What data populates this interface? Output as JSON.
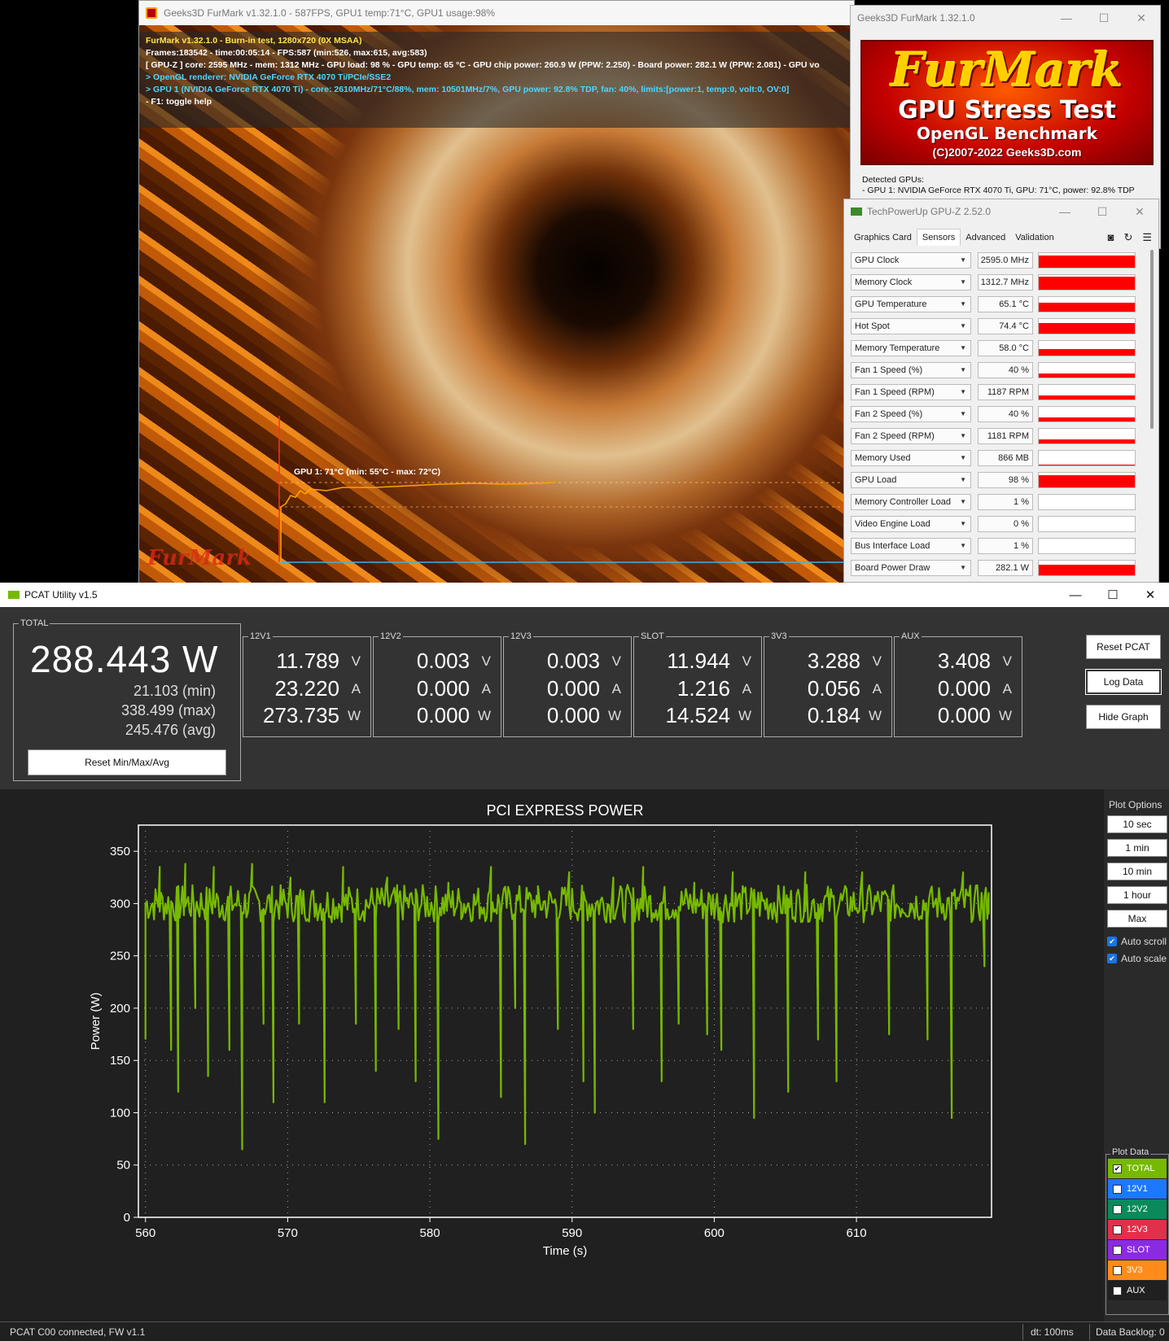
{
  "furmark": {
    "title": "Geeks3D FurMark v1.32.1.0 - 587FPS, GPU1 temp:71°C, GPU1 usage:98%",
    "osd": [
      {
        "text": "FurMark v1.32.1.0 - Burn-in test, 1280x720 (0X MSAA)",
        "color": "yellow"
      },
      {
        "text": "Frames:183542 - time:00:05:14 - FPS:587 (min:526, max:615, avg:583)",
        "color": "white"
      },
      {
        "text": "[ GPU-Z ] core: 2595 MHz - mem: 1312 MHz - GPU load: 98 % - GPU temp: 65 °C - GPU chip power: 260.9 W (PPW: 2.250) - Board power: 282.1 W (PPW: 2.081) - GPU vo",
        "color": "white"
      },
      {
        "text": "> OpenGL renderer: NVIDIA GeForce RTX 4070 Ti/PCIe/SSE2",
        "color": "cyan"
      },
      {
        "text": "> GPU 1 (NVIDIA GeForce RTX 4070 Ti) - core: 2610MHz/71°C/88%, mem: 10501MHz/7%, GPU power: 92.8% TDP, fan: 40%, limits:[power:1, temp:0, volt:0, OV:0]",
        "color": "cyan"
      },
      {
        "text": "- F1: toggle help",
        "color": "white"
      }
    ],
    "graph_label": "GPU 1: 71°C (min: 55°C - max: 72°C)",
    "logo": "FurMark"
  },
  "launcher": {
    "title": "Geeks3D FurMark 1.32.1.0",
    "banner": [
      "FurMark",
      "GPU Stress Test",
      "OpenGL Benchmark",
      "(C)2007-2022 Geeks3D.com"
    ],
    "detected_label": "Detected GPUs:",
    "detected_gpu": "- GPU 1: NVIDIA GeForce RTX 4070 Ti, GPU: 71°C, power: 92.8% TDP"
  },
  "gpuz": {
    "title": "TechPowerUp GPU-Z 2.52.0",
    "tabs": [
      "Graphics Card",
      "Sensors",
      "Advanced",
      "Validation"
    ],
    "sensors": [
      {
        "name": "GPU Clock",
        "value": "2595.0 MHz",
        "level": 0.85
      },
      {
        "name": "Memory Clock",
        "value": "1312.7 MHz",
        "level": 0.9
      },
      {
        "name": "GPU Temperature",
        "value": "65.1 °C",
        "level": 0.6
      },
      {
        "name": "Hot Spot",
        "value": "74.4 °C",
        "level": 0.75
      },
      {
        "name": "Memory Temperature",
        "value": "58.0 °C",
        "level": 0.45
      },
      {
        "name": "Fan 1 Speed (%)",
        "value": "40 %",
        "level": 0.3
      },
      {
        "name": "Fan 1 Speed (RPM)",
        "value": "1187 RPM",
        "level": 0.3
      },
      {
        "name": "Fan 2 Speed (%)",
        "value": "40 %",
        "level": 0.3
      },
      {
        "name": "Fan 2 Speed (RPM)",
        "value": "1181 RPM",
        "level": 0.3
      },
      {
        "name": "Memory Used",
        "value": "866 MB",
        "level": 0.08
      },
      {
        "name": "GPU Load",
        "value": "98 %",
        "level": 0.85
      },
      {
        "name": "Memory Controller Load",
        "value": "1 %",
        "level": 0
      },
      {
        "name": "Video Engine Load",
        "value": "0 %",
        "level": 0
      },
      {
        "name": "Bus Interface Load",
        "value": "1 %",
        "level": 0
      },
      {
        "name": "Board Power Draw",
        "value": "282.1 W",
        "level": 0.7
      }
    ]
  },
  "pcat": {
    "title": "PCAT Utility v1.5",
    "total": {
      "label": "TOTAL",
      "value": "288.443 W",
      "min": "21.103 (min)",
      "max": "338.499 (max)",
      "avg": "245.476 (avg)",
      "reset_label": "Reset Min/Max/Avg"
    },
    "rails": [
      {
        "label": "12V1",
        "v": "11.789",
        "a": "23.220",
        "w": "273.735"
      },
      {
        "label": "12V2",
        "v": "0.003",
        "a": "0.000",
        "w": "0.000"
      },
      {
        "label": "12V3",
        "v": "0.003",
        "a": "0.000",
        "w": "0.000"
      },
      {
        "label": "SLOT",
        "v": "11.944",
        "a": "1.216",
        "w": "14.524"
      },
      {
        "label": "3V3",
        "v": "3.288",
        "a": "0.056",
        "w": "0.184"
      },
      {
        "label": "AUX",
        "v": "3.408",
        "a": "0.000",
        "w": "0.000"
      }
    ],
    "units": {
      "v": "V",
      "a": "A",
      "w": "W"
    },
    "buttons": {
      "reset": "Reset PCAT",
      "log": "Log Data",
      "hide": "Hide Graph"
    },
    "plot_options": {
      "title": "Plot Options",
      "ranges": [
        "10 sec",
        "1 min",
        "10 min",
        "1 hour",
        "Max"
      ],
      "auto_scroll": "Auto scroll",
      "auto_scale": "Auto scale"
    },
    "plot_data": {
      "title": "Plot Data",
      "items": [
        {
          "label": "TOTAL",
          "color": "#76b900",
          "checked": true
        },
        {
          "label": "12V1",
          "color": "#1e78ff",
          "checked": false
        },
        {
          "label": "12V2",
          "color": "#0a8a5a",
          "checked": false
        },
        {
          "label": "12V3",
          "color": "#e0304a",
          "checked": false
        },
        {
          "label": "SLOT",
          "color": "#8a2be2",
          "checked": false
        },
        {
          "label": "3V3",
          "color": "#ff8c1a",
          "checked": false
        },
        {
          "label": "AUX",
          "color": "#202020",
          "checked": false
        }
      ]
    },
    "status": {
      "left": "PCAT C00 connected, FW v1.1",
      "dt": "dt: 100ms",
      "backlog": "Data Backlog: 0"
    }
  },
  "chart_data": {
    "type": "line",
    "title": "PCI EXPRESS POWER",
    "xlabel": "Time (s)",
    "ylabel": "Power (W)",
    "xlim": [
      559.5,
      619.5
    ],
    "ylim": [
      0,
      375
    ],
    "xticks": [
      560,
      570,
      580,
      590,
      600,
      610
    ],
    "yticks": [
      0,
      50,
      100,
      150,
      200,
      250,
      300,
      350
    ],
    "grid": true,
    "line_color": "#76b900",
    "series": [
      {
        "name": "TOTAL",
        "baseline": 300,
        "spikes": [
          {
            "x": 560.0,
            "y": 170
          },
          {
            "x": 561.0,
            "y": 335
          },
          {
            "x": 561.8,
            "y": 160
          },
          {
            "x": 562.3,
            "y": 120
          },
          {
            "x": 562.8,
            "y": 338
          },
          {
            "x": 563.5,
            "y": 200
          },
          {
            "x": 564.4,
            "y": 135
          },
          {
            "x": 564.8,
            "y": 335
          },
          {
            "x": 565.9,
            "y": 160
          },
          {
            "x": 566.8,
            "y": 65
          },
          {
            "x": 567.5,
            "y": 338
          },
          {
            "x": 568.3,
            "y": 185
          },
          {
            "x": 569.0,
            "y": 110
          },
          {
            "x": 570.2,
            "y": 325
          },
          {
            "x": 570.8,
            "y": 185
          },
          {
            "x": 572.6,
            "y": 110
          },
          {
            "x": 573.9,
            "y": 335
          },
          {
            "x": 574.8,
            "y": 185
          },
          {
            "x": 576.2,
            "y": 140
          },
          {
            "x": 577.0,
            "y": 325
          },
          {
            "x": 577.8,
            "y": 180
          },
          {
            "x": 579.0,
            "y": 130
          },
          {
            "x": 580.6,
            "y": 75
          },
          {
            "x": 581.3,
            "y": 320
          },
          {
            "x": 582.2,
            "y": 300
          },
          {
            "x": 584.3,
            "y": 335
          },
          {
            "x": 585.0,
            "y": 115
          },
          {
            "x": 586.0,
            "y": 200
          },
          {
            "x": 586.7,
            "y": 70
          },
          {
            "x": 587.6,
            "y": 300
          },
          {
            "x": 589.0,
            "y": 180
          },
          {
            "x": 589.8,
            "y": 330
          },
          {
            "x": 590.8,
            "y": 130
          },
          {
            "x": 591.6,
            "y": 100
          },
          {
            "x": 592.9,
            "y": 325
          },
          {
            "x": 594.3,
            "y": 180
          },
          {
            "x": 595.0,
            "y": 335
          },
          {
            "x": 596.3,
            "y": 130
          },
          {
            "x": 597.5,
            "y": 185
          },
          {
            "x": 598.6,
            "y": 320
          },
          {
            "x": 599.5,
            "y": 175
          },
          {
            "x": 600.5,
            "y": 160
          },
          {
            "x": 601.3,
            "y": 330
          },
          {
            "x": 602.8,
            "y": 95
          },
          {
            "x": 604.0,
            "y": 300
          },
          {
            "x": 605.2,
            "y": 120
          },
          {
            "x": 606.4,
            "y": 330
          },
          {
            "x": 607.3,
            "y": 170
          },
          {
            "x": 608.6,
            "y": 130
          },
          {
            "x": 610.4,
            "y": 330
          },
          {
            "x": 612.3,
            "y": 175
          },
          {
            "x": 613.8,
            "y": 300
          },
          {
            "x": 615.0,
            "y": 170
          },
          {
            "x": 616.7,
            "y": 95
          },
          {
            "x": 617.5,
            "y": 330
          },
          {
            "x": 619.0,
            "y": 240
          },
          {
            "x": 619.3,
            "y": 310
          }
        ]
      }
    ]
  }
}
